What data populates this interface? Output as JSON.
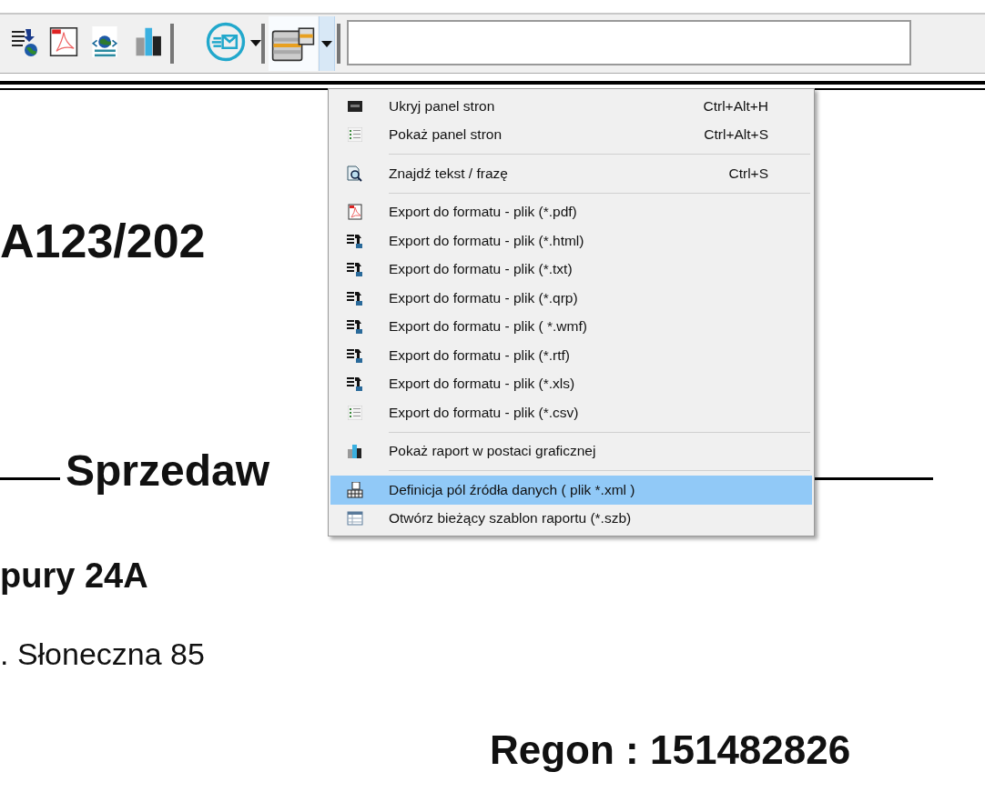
{
  "toolbar": {
    "template_dropdown": {
      "pressed": true
    }
  },
  "document": {
    "lines": [
      {
        "kind": "number",
        "text": "A123/202"
      },
      {
        "kind": "heading",
        "text": "Sprzedaw"
      },
      {
        "kind": "bold",
        "text": "pury 24A"
      },
      {
        "kind": "plain",
        "text": ". Słoneczna 85"
      },
      {
        "kind": "regon",
        "text": "Regon : 151482826"
      }
    ]
  },
  "menu": {
    "items": [
      {
        "kind": "item",
        "label": "Ukryj panel  stron",
        "shortcut": "Ctrl+Alt+H",
        "selected": false
      },
      {
        "kind": "item",
        "label": "Pokaż panel stron",
        "shortcut": "Ctrl+Alt+S",
        "selected": false
      },
      {
        "kind": "separator"
      },
      {
        "kind": "item",
        "label": "Znajdź  tekst / frazę",
        "shortcut": "Ctrl+S",
        "selected": false
      },
      {
        "kind": "separator"
      },
      {
        "kind": "item",
        "label": "Export do formatu - plik (*.pdf)",
        "selected": false
      },
      {
        "kind": "item",
        "label": "Export do formatu - plik (*.html)",
        "selected": false
      },
      {
        "kind": "item",
        "label": "Export do formatu - plik  (*.txt)",
        "selected": false
      },
      {
        "kind": "item",
        "label": "Export do formatu - plik (*.qrp)",
        "selected": false
      },
      {
        "kind": "item",
        "label": "Export do formatu - plik ( *.wmf)",
        "selected": false
      },
      {
        "kind": "item",
        "label": "Export do formatu - plik (*.rtf)",
        "selected": false
      },
      {
        "kind": "item",
        "label": "Export do formatu - plik (*.xls)",
        "selected": false
      },
      {
        "kind": "item",
        "label": "Export do formatu - plik  (*.csv)",
        "selected": false
      },
      {
        "kind": "separator"
      },
      {
        "kind": "item",
        "label": "Pokaż raport w postaci graficznej",
        "selected": false
      },
      {
        "kind": "separator"
      },
      {
        "kind": "item",
        "label": "Definicja pól źródła danych ( plik *.xml )",
        "selected": true
      },
      {
        "kind": "item",
        "label": "Otwórz bieżący szablon raportu (*.szb)",
        "selected": false
      }
    ]
  }
}
